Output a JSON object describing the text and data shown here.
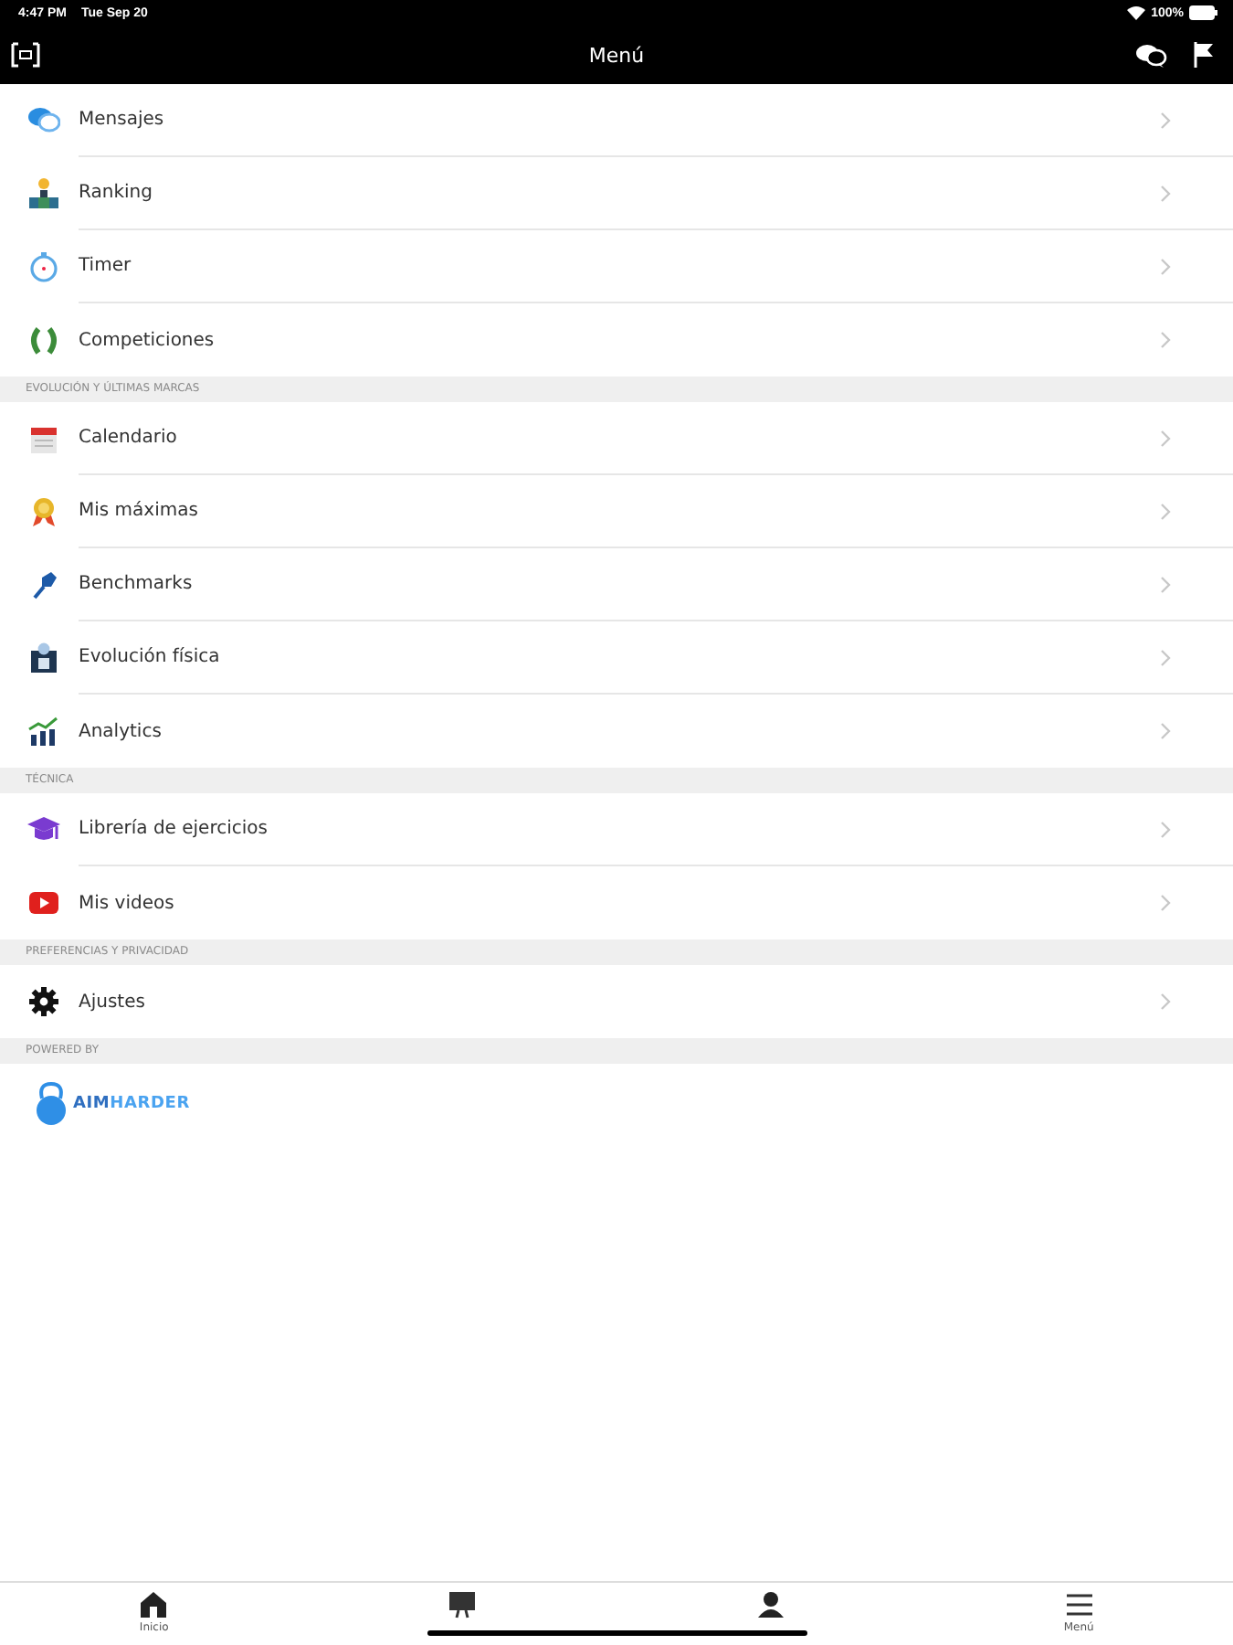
{
  "status_bar": {
    "time": "4:47 PM",
    "date": "Tue Sep 20",
    "battery": "100%"
  },
  "nav_bar": {
    "title": "Menú"
  },
  "sections": [
    {
      "items": [
        {
          "label": "Mensajes"
        },
        {
          "label": "Ranking"
        },
        {
          "label": "Timer"
        },
        {
          "label": "Competiciones"
        }
      ]
    },
    {
      "header": "EVOLUCIÓN Y ÚLTIMAS MARCAS",
      "items": [
        {
          "label": "Calendario"
        },
        {
          "label": "Mis máximas"
        },
        {
          "label": "Benchmarks"
        },
        {
          "label": "Evolución física"
        },
        {
          "label": "Analytics"
        }
      ]
    },
    {
      "header": "TÉCNICA",
      "items": [
        {
          "label": "Librería de ejercicios"
        },
        {
          "label": "Mis videos"
        }
      ]
    },
    {
      "header": "PREFERENCIAS Y PRIVACIDAD",
      "items": [
        {
          "label": "Ajustes"
        }
      ]
    },
    {
      "header": "POWERED BY",
      "logo": {
        "brand_a": "AIM",
        "brand_b": "HARDER"
      }
    }
  ],
  "tab_bar": [
    {
      "kind": "labeled",
      "label": "Inicio"
    },
    {
      "kind": "covered"
    },
    {
      "kind": "covered"
    },
    {
      "kind": "labeled",
      "label": "Menú"
    }
  ]
}
